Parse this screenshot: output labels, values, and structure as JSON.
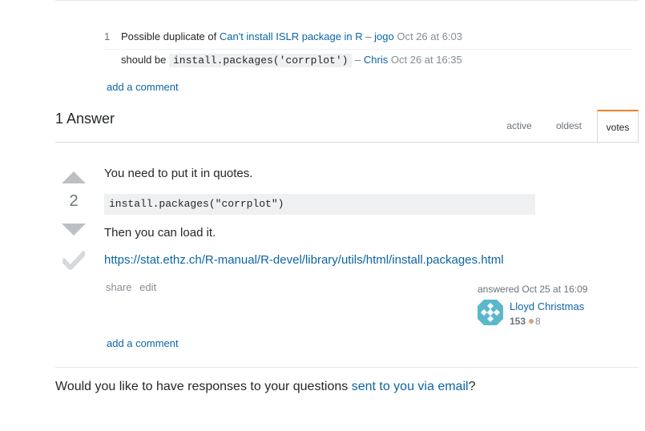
{
  "comments": [
    {
      "score": "1",
      "text_before": "Possible duplicate of ",
      "link": "Can't install ISLR package in R",
      "sep": " – ",
      "author": "jogo",
      "date": "Oct 26 at 6:03"
    },
    {
      "score": "",
      "text_before": "should be ",
      "code": "install.packages('corrplot')",
      "sep": " – ",
      "author": "Chris",
      "date": "Oct 26 at 16:35"
    }
  ],
  "add_comment_label": "add a comment",
  "answers_title": "1 Answer",
  "tabs": [
    "active",
    "oldest",
    "votes"
  ],
  "selected_tab": "votes",
  "answer": {
    "vote_count": "2",
    "line1": "You need to put it in quotes.",
    "code": "install.packages(\"corrplot\")",
    "line2": "Then you can load it.",
    "link": "https://stat.ethz.ch/R-manual/R-devel/library/utils/html/install.packages.html",
    "menu": [
      "share",
      "edit"
    ],
    "signature": {
      "action": "answered Oct 25 at 16:09",
      "user": "Lloyd Christmas",
      "reputation": "153",
      "bronze": "8"
    }
  },
  "answer_add_comment": "add a comment",
  "footer": {
    "before": "Would you like to have responses to your questions ",
    "link": "sent to you via email",
    "after": "?"
  },
  "colors": {
    "link": "#0c65a5",
    "tab_accent": "#f48024",
    "vote_arrow": "#bbc0c4",
    "avatar": "#5bb8cc"
  }
}
